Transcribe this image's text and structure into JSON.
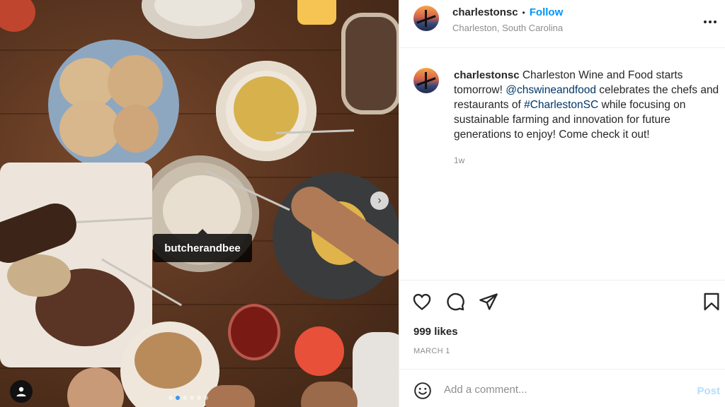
{
  "media": {
    "tag_label": "butcherandbee",
    "carousel": {
      "total": 6,
      "active": 1
    },
    "next_icon": "chevron-right-icon",
    "user_tag_icon": "user-icon"
  },
  "header": {
    "username": "charlestonsc",
    "separator": "•",
    "follow_label": "Follow",
    "location": "Charleston, South Carolina",
    "more_label": "..."
  },
  "caption": {
    "username": "charlestonsc",
    "text_1": " Charleston Wine and Food starts tomorrow! ",
    "mention": "@chswineandfood",
    "text_2": " celebrates the chefs and restaurants of ",
    "hashtag": "#CharlestonSC",
    "text_3": " while focusing on sustainable farming and innovation for future generations to enjoy! Come check it out!",
    "time_ago": "1w"
  },
  "actions": {
    "icons": [
      "heart-icon",
      "comment-icon",
      "share-icon",
      "bookmark-icon"
    ],
    "likes": "999 likes",
    "date": "MARCH 1"
  },
  "comment": {
    "placeholder": "Add a comment...",
    "post_label": "Post",
    "emoji_icon": "emoji-icon"
  },
  "colors": {
    "accent": "#0095f6",
    "link": "#00376b",
    "muted": "#8e8e8e",
    "post_disabled": "#b2dffc"
  }
}
